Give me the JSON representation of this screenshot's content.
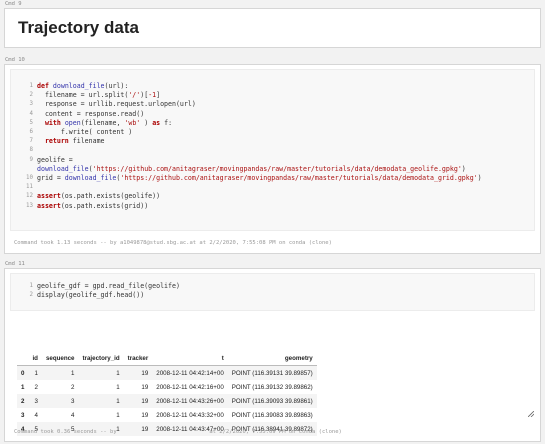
{
  "cells": [
    {
      "label": "Cmd 9",
      "title": "Trajectory data"
    },
    {
      "label": "Cmd 10",
      "lines": [
        {
          "n": "1",
          "text": "def download_file(url):"
        },
        {
          "n": "2",
          "text": "  filename = url.split('/')[-1]"
        },
        {
          "n": "3",
          "text": "  response = urllib.request.urlopen(url)"
        },
        {
          "n": "4",
          "text": "  content = response.read()"
        },
        {
          "n": "5",
          "text": "  with open(filename, 'wb' ) as f:"
        },
        {
          "n": "6",
          "text": "      f.write( content )"
        },
        {
          "n": "7",
          "text": "  return filename"
        },
        {
          "n": "8",
          "text": ""
        },
        {
          "n": "9",
          "text": "geolife ="
        },
        {
          "n": "",
          "text": "download_file('https://github.com/anitagraser/movingpandas/raw/master/tutorials/data/demodata_geolife.gpkg')"
        },
        {
          "n": "10",
          "text": "grid = download_file('https://github.com/anitagraser/movingpandas/raw/master/tutorials/data/demodata_grid.gpkg')"
        },
        {
          "n": "11",
          "text": ""
        },
        {
          "n": "12",
          "text": "assert(os.path.exists(geolife))"
        },
        {
          "n": "13",
          "text": "assert(os.path.exists(grid))"
        }
      ],
      "footer": "Command took 1.13 seconds -- by a1049878@stud.sbg.ac.at at 2/2/2020, 7:55:08 PM on conda (clone)"
    },
    {
      "label": "Cmd 11",
      "lines": [
        {
          "n": "1",
          "text": "geolife_gdf = gpd.read_file(geolife)"
        },
        {
          "n": "2",
          "text": "display(geolife_gdf.head())"
        }
      ],
      "table": {
        "columns": [
          "",
          "id",
          "sequence",
          "trajectory_id",
          "tracker",
          "t",
          "geometry"
        ],
        "rows": [
          [
            "0",
            "1",
            "1",
            "1",
            "19",
            "2008-12-11 04:42:14+00",
            "POINT (116.39131 39.89857)"
          ],
          [
            "1",
            "2",
            "2",
            "1",
            "19",
            "2008-12-11 04:42:16+00",
            "POINT (116.39132 39.89862)"
          ],
          [
            "2",
            "3",
            "3",
            "1",
            "19",
            "2008-12-11 04:43:26+00",
            "POINT (116.39093 39.89861)"
          ],
          [
            "3",
            "4",
            "4",
            "1",
            "19",
            "2008-12-11 04:43:32+00",
            "POINT (116.39083 39.89863)"
          ],
          [
            "4",
            "5",
            "5",
            "1",
            "19",
            "2008-12-11 04:43:47+00",
            "POINT (116.38941 39.89872)"
          ]
        ]
      },
      "footer": "Command took 0.36 seconds -- by                            at 2/2/2020, 7:55:09 PM on conda (clone)"
    }
  ]
}
